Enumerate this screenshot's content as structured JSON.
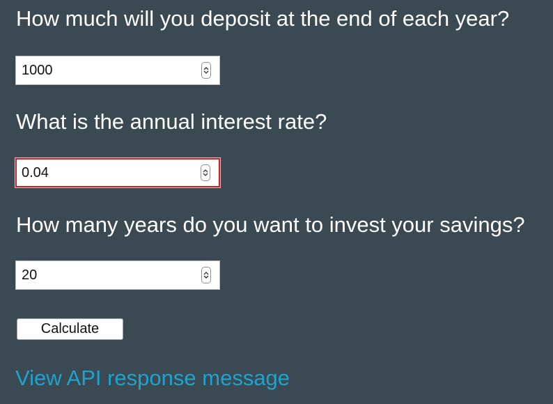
{
  "form": {
    "deposit": {
      "question": "How much will you deposit at the end of each year?",
      "value": "1000"
    },
    "interest": {
      "question": "What is the annual interest rate?",
      "value": "0.04",
      "state": "invalid"
    },
    "years": {
      "question": "How many years do you want to invest your savings?",
      "value": "20"
    },
    "calculate_label": "Calculate"
  },
  "api_link": {
    "label": "View API response message"
  },
  "colors": {
    "background": "#3b4a52",
    "text": "#ffffff",
    "link": "#1ea3cf",
    "invalid_border": "#c4252a"
  },
  "icons": {
    "spinner": "stepper-up-down-icon"
  }
}
